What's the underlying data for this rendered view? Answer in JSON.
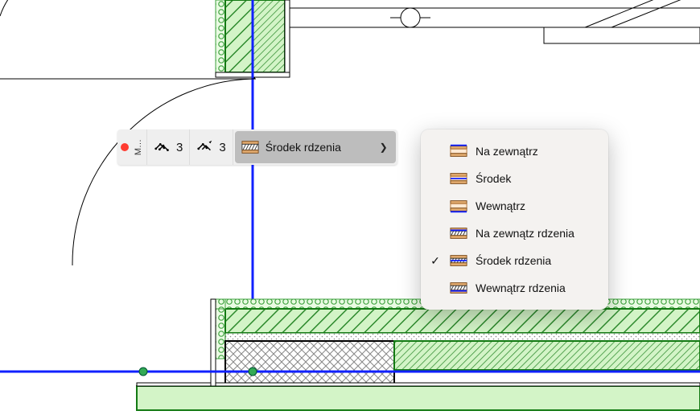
{
  "toolbar": {
    "modify_label": "M…",
    "count_a": "3",
    "count_b": "3",
    "dropdown_label": "Środek rdzenia"
  },
  "menu": {
    "items": [
      {
        "label": "Na zewnątrz",
        "checked": false,
        "icon": "solid"
      },
      {
        "label": "Środek",
        "checked": false,
        "icon": "solid"
      },
      {
        "label": "Wewnątrz",
        "checked": false,
        "icon": "solid"
      },
      {
        "label": "Na zewnątz rdzenia",
        "checked": false,
        "icon": "hatch"
      },
      {
        "label": "Środek rdzenia",
        "checked": true,
        "icon": "hatch"
      },
      {
        "label": "Wewnątrz rdzenia",
        "checked": false,
        "icon": "hatch"
      }
    ]
  }
}
